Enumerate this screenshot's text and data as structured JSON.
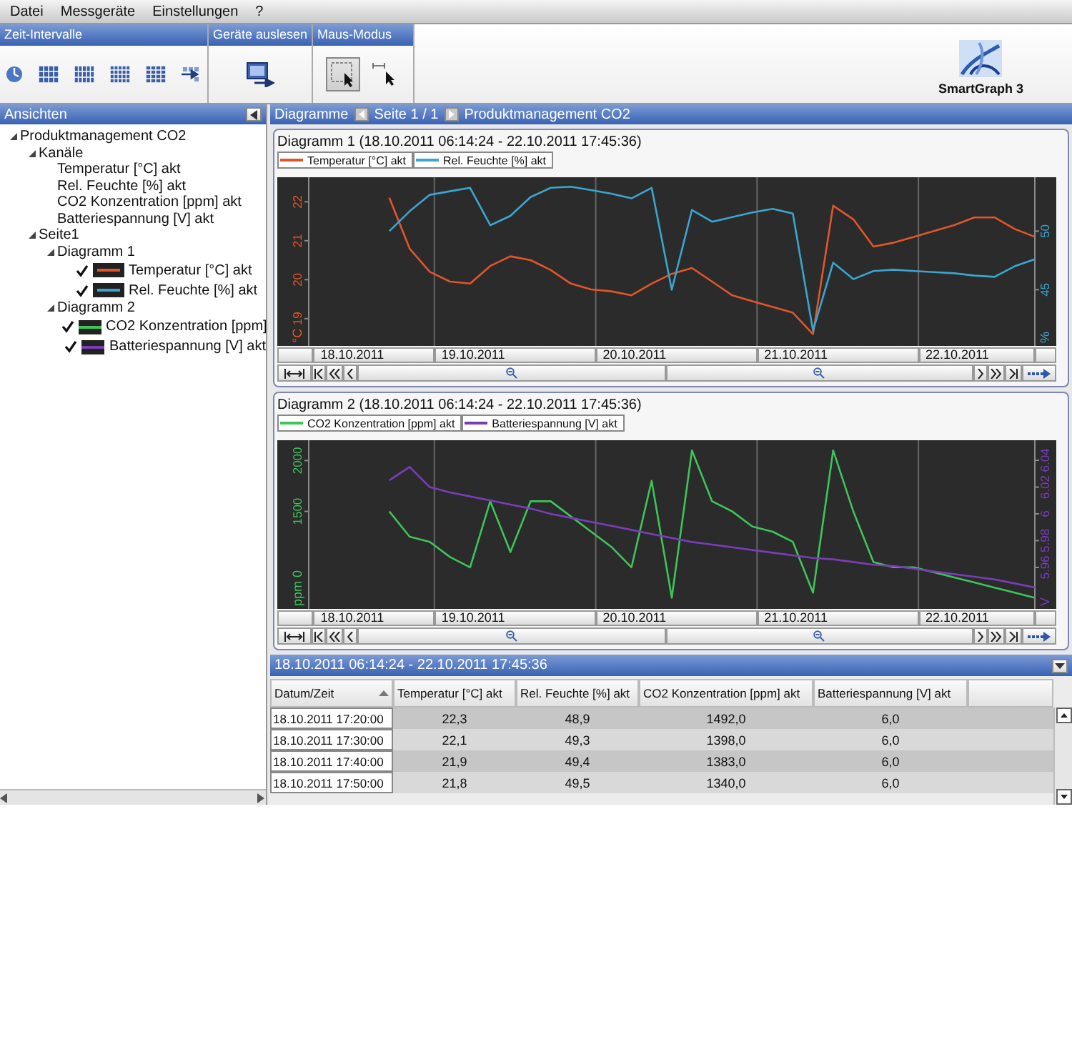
{
  "menu": [
    "Datei",
    "Messgeräte",
    "Einstellungen",
    "?"
  ],
  "ribbon": {
    "groups": [
      {
        "title": "Zeit-Intervalle",
        "kind": "intervals"
      },
      {
        "title": "Geräte auslesen",
        "kind": "readout"
      },
      {
        "title": "Maus-Modus",
        "kind": "mouse-mode",
        "modes": [
          {
            "selected": true
          },
          {
            "selected": false
          }
        ]
      }
    ],
    "app_title": "SmartGraph 3"
  },
  "sidebar": {
    "title": "Ansichten",
    "tree": [
      {
        "label": "Produktmanagement CO2",
        "expanded": true,
        "children": [
          {
            "label": "Kanäle",
            "expanded": true,
            "children": [
              {
                "label": "Temperatur [°C] akt"
              },
              {
                "label": "Rel. Feuchte [%] akt"
              },
              {
                "label": "CO2 Konzentration [ppm] akt"
              },
              {
                "label": "Batteriespannung [V] akt"
              }
            ]
          },
          {
            "label": "Seite1",
            "expanded": true,
            "children": [
              {
                "label": "Diagramm 1",
                "expanded": true,
                "children": [
                  {
                    "label": "Temperatur [°C] akt",
                    "checked": true,
                    "color": "#e0562a"
                  },
                  {
                    "label": "Rel. Feuchte [%] akt",
                    "checked": true,
                    "color": "#3aa6d0"
                  }
                ]
              },
              {
                "label": "Diagramm 2",
                "expanded": true,
                "children": [
                  {
                    "label": "CO2 Konzentration [ppm]",
                    "checked": true,
                    "color": "#3ec45a"
                  },
                  {
                    "label": "Batteriespannung [V] akt",
                    "checked": true,
                    "color": "#7a3db8"
                  }
                ]
              }
            ]
          }
        ]
      }
    ]
  },
  "breadcrumb": {
    "section": "Diagramme",
    "page": "Seite 1 / 1",
    "title": "Produktmanagement CO2"
  },
  "charts": [
    {
      "title": "Diagramm 1 (18.10.2011 06:14:24 - 22.10.2011 17:45:36)",
      "layers": [
        {
          "right_axis": false,
          "chart_data": {
            "type": "line",
            "grid": true,
            "categories": [
              null,
              null,
              "18.10.2011",
              null,
              null,
              null,
              null,
              null,
              "19.10.2011",
              null,
              null,
              null,
              null,
              null,
              null,
              null,
              "20.10.2011",
              null,
              null,
              null,
              null,
              null,
              null,
              null,
              "21.10.2011",
              null,
              null,
              null,
              null,
              null,
              null,
              null,
              "22.10.2011",
              null,
              null,
              null,
              null
            ],
            "ylabel": "°C",
            "ylim": [
              18.3,
              22.63
            ],
            "yticks": [
              19,
              20,
              21,
              22
            ],
            "series": [
              {
                "name": "Temperatur [°C] akt",
                "color": "#e0562a",
                "values": [
                  null,
                  null,
                  null,
                  null,
                  22.1,
                  20.8,
                  20.2,
                  19.95,
                  19.9,
                  20.35,
                  20.6,
                  20.5,
                  20.25,
                  19.9,
                  19.75,
                  19.7,
                  19.6,
                  19.9,
                  20.15,
                  20.3,
                  19.95,
                  19.6,
                  19.45,
                  19.3,
                  19.15,
                  18.6,
                  21.9,
                  21.55,
                  20.85,
                  20.95,
                  21.1,
                  21.25,
                  21.4,
                  21.6,
                  21.6,
                  21.3,
                  21.1
                ]
              }
            ]
          }
        },
        {
          "right_axis": true,
          "chart_data": {
            "type": "line",
            "ylabel": "%",
            "ylim": [
              40.2,
              54.6
            ],
            "yticks": [
              45,
              50
            ],
            "series": [
              {
                "name": "Rel. Feuchte [%] akt",
                "color": "#3aa6d0",
                "values": [
                  null,
                  null,
                  null,
                  null,
                  50.0,
                  51.7,
                  53.1,
                  53.4,
                  53.7,
                  50.5,
                  51.3,
                  52.9,
                  53.7,
                  53.8,
                  53.5,
                  53.2,
                  52.8,
                  53.7,
                  45.0,
                  51.8,
                  50.8,
                  51.2,
                  51.6,
                  51.9,
                  51.5,
                  41.5,
                  47.3,
                  45.9,
                  46.6,
                  46.7,
                  46.6,
                  46.5,
                  46.4,
                  46.2,
                  46.1,
                  47.0,
                  47.6
                ]
              }
            ]
          }
        }
      ]
    },
    {
      "title": "Diagramm 2 (18.10.2011 06:14:24 - 22.10.2011 17:45:36)",
      "layers": [
        {
          "right_axis": false,
          "chart_data": {
            "type": "line",
            "grid": true,
            "categories": [
              null,
              null,
              "18.10.2011",
              null,
              null,
              null,
              null,
              null,
              "19.10.2011",
              null,
              null,
              null,
              null,
              null,
              null,
              null,
              "20.10.2011",
              null,
              null,
              null,
              null,
              null,
              null,
              null,
              "21.10.2011",
              null,
              null,
              null,
              null,
              null,
              null,
              null,
              "22.10.2011",
              null,
              null,
              null,
              null
            ],
            "ylabel": "ppm 0",
            "ylim": [
              540,
              2200
            ],
            "yticks": [
              1500,
              2000
            ],
            "series": [
              {
                "name": "CO2 Konzentration [ppm] akt",
                "color": "#3ec45a",
                "values": [
                  null,
                  null,
                  null,
                  null,
                  1500,
                  1250,
                  1200,
                  1050,
                  950,
                  1600,
                  1100,
                  1600,
                  1600,
                  1450,
                  1300,
                  1150,
                  950,
                  1800,
                  650,
                  2100,
                  1600,
                  1500,
                  1350,
                  1300,
                  1200,
                  700,
                  2100,
                  1500,
                  1000,
                  950,
                  950,
                  900,
                  850,
                  800,
                  750,
                  700,
                  650
                ]
              }
            ]
          }
        },
        {
          "right_axis": true,
          "chart_data": {
            "type": "line",
            "ylabel": "V",
            "ylim": [
              5.929,
              6.055
            ],
            "yticks": [
              5.96,
              5.98,
              6,
              6.02,
              6.04
            ],
            "series": [
              {
                "name": "Batteriespannung [V] akt",
                "color": "#7a3db8",
                "values": [
                  null,
                  null,
                  null,
                  null,
                  6.025,
                  6.035,
                  6.02,
                  6.016,
                  6.013,
                  6.01,
                  6.007,
                  6.004,
                  6.0,
                  5.997,
                  5.994,
                  5.991,
                  5.988,
                  5.985,
                  5.982,
                  5.979,
                  5.977,
                  5.975,
                  5.973,
                  5.971,
                  5.969,
                  5.967,
                  5.966,
                  5.964,
                  5.962,
                  5.961,
                  5.959,
                  5.957,
                  5.955,
                  5.953,
                  5.951,
                  5.948,
                  5.945
                ]
              }
            ]
          }
        }
      ]
    }
  ],
  "table": {
    "title": "18.10.2011 06:14:24 - 22.10.2011 17:45:36",
    "columns": [
      {
        "label": "Datum/Zeit",
        "sort_ascending": true
      },
      {
        "label": "Temperatur [°C] akt"
      },
      {
        "label": "Rel. Feuchte [%] akt"
      },
      {
        "label": "CO2 Konzentration [ppm] akt"
      },
      {
        "label": "Batteriespannung [V] akt"
      }
    ],
    "rows": [
      [
        "18.10.2011 17:20:00",
        "22,3",
        "48,9",
        "1492,0",
        "6,0"
      ],
      [
        "18.10.2011 17:30:00",
        "22,1",
        "49,3",
        "1398,0",
        "6,0"
      ],
      [
        "18.10.2011 17:40:00",
        "21,9",
        "49,4",
        "1383,0",
        "6,0"
      ],
      [
        "18.10.2011 17:50:00",
        "21,8",
        "49,5",
        "1340,0",
        "6,0"
      ]
    ]
  }
}
